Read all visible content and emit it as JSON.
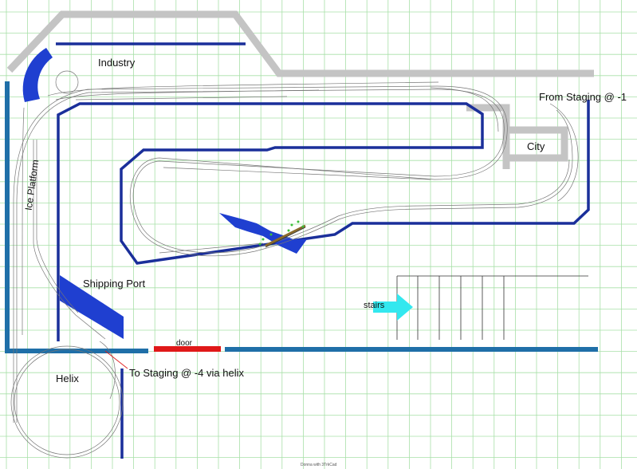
{
  "labels": {
    "industry": "Industry",
    "from_staging": "From Staging @ -1",
    "city": "City",
    "ice_platform": "Ice Platform",
    "shipping_port": "Shipping Port",
    "stairs": "stairs",
    "door": "door",
    "to_staging": "To Staging @ -4 via helix",
    "helix": "Helix",
    "footer": "Donna with 3TrkCad"
  },
  "colors": {
    "background": "#ffffff",
    "grid": "#a8e0a8",
    "fascia": "#1a2f9a",
    "wall": "#1f6fa8",
    "door": "#e01818",
    "road": "#c4c4c4",
    "water": "#1f3fd0",
    "track": "#777777",
    "stairs_arrow": "#33e8ef"
  },
  "icons": {
    "stairs_arrow": "right-arrow-icon"
  }
}
